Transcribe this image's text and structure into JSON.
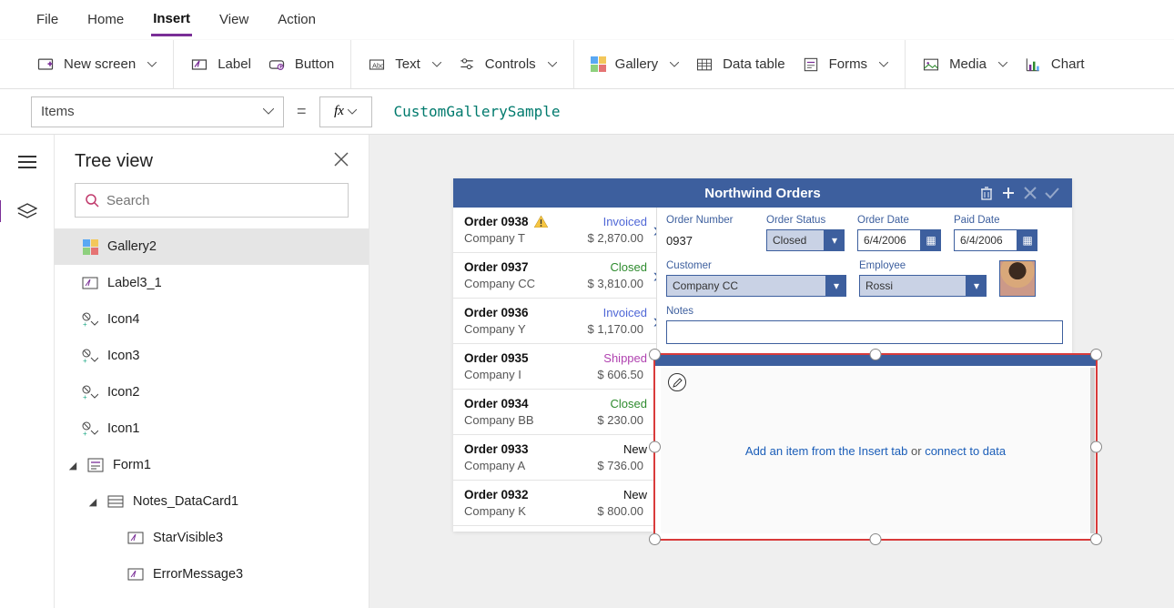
{
  "menu": {
    "file": "File",
    "home": "Home",
    "insert": "Insert",
    "view": "View",
    "action": "Action"
  },
  "ribbon": {
    "newScreen": "New screen",
    "label": "Label",
    "button": "Button",
    "text": "Text",
    "controls": "Controls",
    "gallery": "Gallery",
    "dataTable": "Data table",
    "forms": "Forms",
    "media": "Media",
    "chart": "Chart"
  },
  "fx": {
    "property": "Items",
    "formula": "CustomGallerySample"
  },
  "tree": {
    "title": "Tree view",
    "searchPlaceholder": "Search",
    "nodes": {
      "gallery2": "Gallery2",
      "label3_1": "Label3_1",
      "icon4": "Icon4",
      "icon3": "Icon3",
      "icon2": "Icon2",
      "icon1": "Icon1",
      "form1": "Form1",
      "notesDC": "Notes_DataCard1",
      "starVisible3": "StarVisible3",
      "errorMessage3": "ErrorMessage3"
    }
  },
  "appTitle": "Northwind Orders",
  "orders": [
    {
      "name": "Order 0938",
      "company": "Company T",
      "amount": "$ 2,870.00",
      "status": "Invoiced",
      "statusClass": "s-invoiced",
      "warn": true
    },
    {
      "name": "Order 0937",
      "company": "Company CC",
      "amount": "$ 3,810.00",
      "status": "Closed",
      "statusClass": "s-closed",
      "warn": false
    },
    {
      "name": "Order 0936",
      "company": "Company Y",
      "amount": "$ 1,170.00",
      "status": "Invoiced",
      "statusClass": "s-invoiced",
      "warn": false
    },
    {
      "name": "Order 0935",
      "company": "Company I",
      "amount": "$ 606.50",
      "status": "Shipped",
      "statusClass": "s-shipped",
      "warn": false
    },
    {
      "name": "Order 0934",
      "company": "Company BB",
      "amount": "$ 230.00",
      "status": "Closed",
      "statusClass": "s-closed",
      "warn": false
    },
    {
      "name": "Order 0933",
      "company": "Company A",
      "amount": "$ 736.00",
      "status": "New",
      "statusClass": "s-new",
      "warn": false
    },
    {
      "name": "Order 0932",
      "company": "Company K",
      "amount": "$ 800.00",
      "status": "New",
      "statusClass": "s-new",
      "warn": false
    }
  ],
  "detail": {
    "labels": {
      "orderNumber": "Order Number",
      "orderStatus": "Order Status",
      "orderDate": "Order Date",
      "paidDate": "Paid Date",
      "customer": "Customer",
      "employee": "Employee",
      "notes": "Notes"
    },
    "orderNumber": "0937",
    "orderStatus": "Closed",
    "orderDate": "6/4/2006",
    "paidDate": "6/4/2006",
    "customer": "Company CC",
    "employee": "Rossi",
    "notes": ""
  },
  "placeholder": {
    "addItem": "Add an item from the Insert tab",
    "or": " or ",
    "connect": "connect to data"
  }
}
